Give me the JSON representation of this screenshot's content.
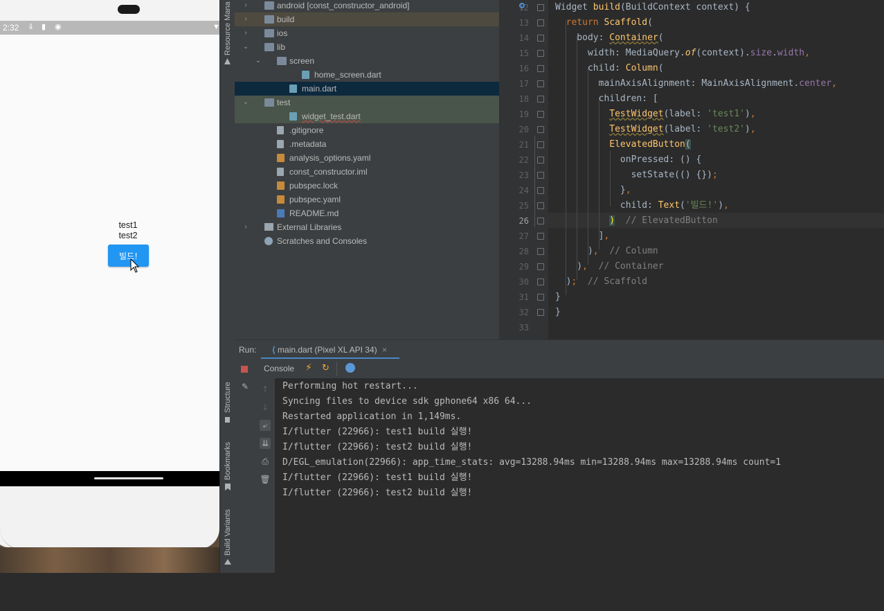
{
  "emulator": {
    "status_time": "2:32",
    "app_texts": [
      "test1",
      "test2"
    ],
    "button_label": "빌드!"
  },
  "tool_strip": {
    "resource_manager": "Resource Mana",
    "structure": "Structure",
    "bookmarks": "Bookmarks",
    "build_variants": "Build Variants"
  },
  "project_tree": {
    "items": [
      {
        "label": "android [const_constructor_android]",
        "indent": 0,
        "arrow": "›",
        "icon": "folder",
        "row_bg": "#3c3f41"
      },
      {
        "label": "build",
        "indent": 0,
        "arrow": "›",
        "icon": "folder",
        "row_bg": "#4e4a3f"
      },
      {
        "label": "ios",
        "indent": 0,
        "arrow": "›",
        "icon": "folder",
        "row_bg": "#3c3f41"
      },
      {
        "label": "lib",
        "indent": 0,
        "arrow": "⌄",
        "icon": "folder",
        "row_bg": "#3c3f41"
      },
      {
        "label": "screen",
        "indent": 1,
        "arrow": "⌄",
        "icon": "folder",
        "row_bg": "#3c3f41"
      },
      {
        "label": "home_screen.dart",
        "indent": 3,
        "arrow": "",
        "icon": "dart",
        "row_bg": "#3c3f41"
      },
      {
        "label": "main.dart",
        "indent": 2,
        "arrow": "",
        "icon": "dart",
        "row_bg": "#0d293e"
      },
      {
        "label": "test",
        "indent": 0,
        "arrow": "⌄",
        "icon": "folder",
        "row_bg": "#49544a"
      },
      {
        "label": "widget_test.dart",
        "indent": 2,
        "arrow": "",
        "icon": "dart",
        "row_bg": "#49544a"
      },
      {
        "label": ".gitignore",
        "indent": 1,
        "arrow": "",
        "icon": "file",
        "row_bg": "#3c3f41"
      },
      {
        "label": ".metadata",
        "indent": 1,
        "arrow": "",
        "icon": "file",
        "row_bg": "#3c3f41"
      },
      {
        "label": "analysis_options.yaml",
        "indent": 1,
        "arrow": "",
        "icon": "yaml",
        "row_bg": "#3c3f41"
      },
      {
        "label": "const_constructor.iml",
        "indent": 1,
        "arrow": "",
        "icon": "file",
        "row_bg": "#3c3f41"
      },
      {
        "label": "pubspec.lock",
        "indent": 1,
        "arrow": "",
        "icon": "yaml",
        "row_bg": "#3c3f41"
      },
      {
        "label": "pubspec.yaml",
        "indent": 1,
        "arrow": "",
        "icon": "yaml",
        "row_bg": "#3c3f41"
      },
      {
        "label": "README.md",
        "indent": 1,
        "arrow": "",
        "icon": "md",
        "row_bg": "#3c3f41"
      },
      {
        "label": "External Libraries",
        "indent": 0,
        "arrow": "›",
        "icon": "lib",
        "row_bg": "#3c3f41"
      },
      {
        "label": "Scratches and Consoles",
        "indent": 0,
        "arrow": "",
        "icon": "scratch",
        "row_bg": "#3c3f41"
      }
    ]
  },
  "editor": {
    "line_numbers": [
      "12",
      "13",
      "14",
      "15",
      "16",
      "17",
      "18",
      "19",
      "20",
      "21",
      "22",
      "23",
      "24",
      "25",
      "26",
      "27",
      "28",
      "29",
      "30",
      "31",
      "32",
      "33"
    ],
    "active_line": "26"
  },
  "run": {
    "label": "Run:",
    "tab": "main.dart (Pixel XL API 34)",
    "close": "×",
    "console_tab": "Console"
  },
  "console": {
    "lines": [
      "Performing hot restart...",
      "Syncing files to device sdk gphone64 x86 64...",
      "Restarted application in 1,149ms.",
      "I/flutter (22966): test1 build 실행!",
      "I/flutter (22966): test2 build 실행!",
      "D/EGL_emulation(22966): app_time_stats: avg=13288.94ms min=13288.94ms max=13288.94ms count=1",
      "I/flutter (22966): test1 build 실행!",
      "I/flutter (22966): test2 build 실행!"
    ]
  },
  "colors": {
    "button_blue": "#2196f3",
    "keyword": "#cc7832",
    "function": "#ffc66d",
    "string": "#6a8759",
    "comment": "#808080"
  }
}
